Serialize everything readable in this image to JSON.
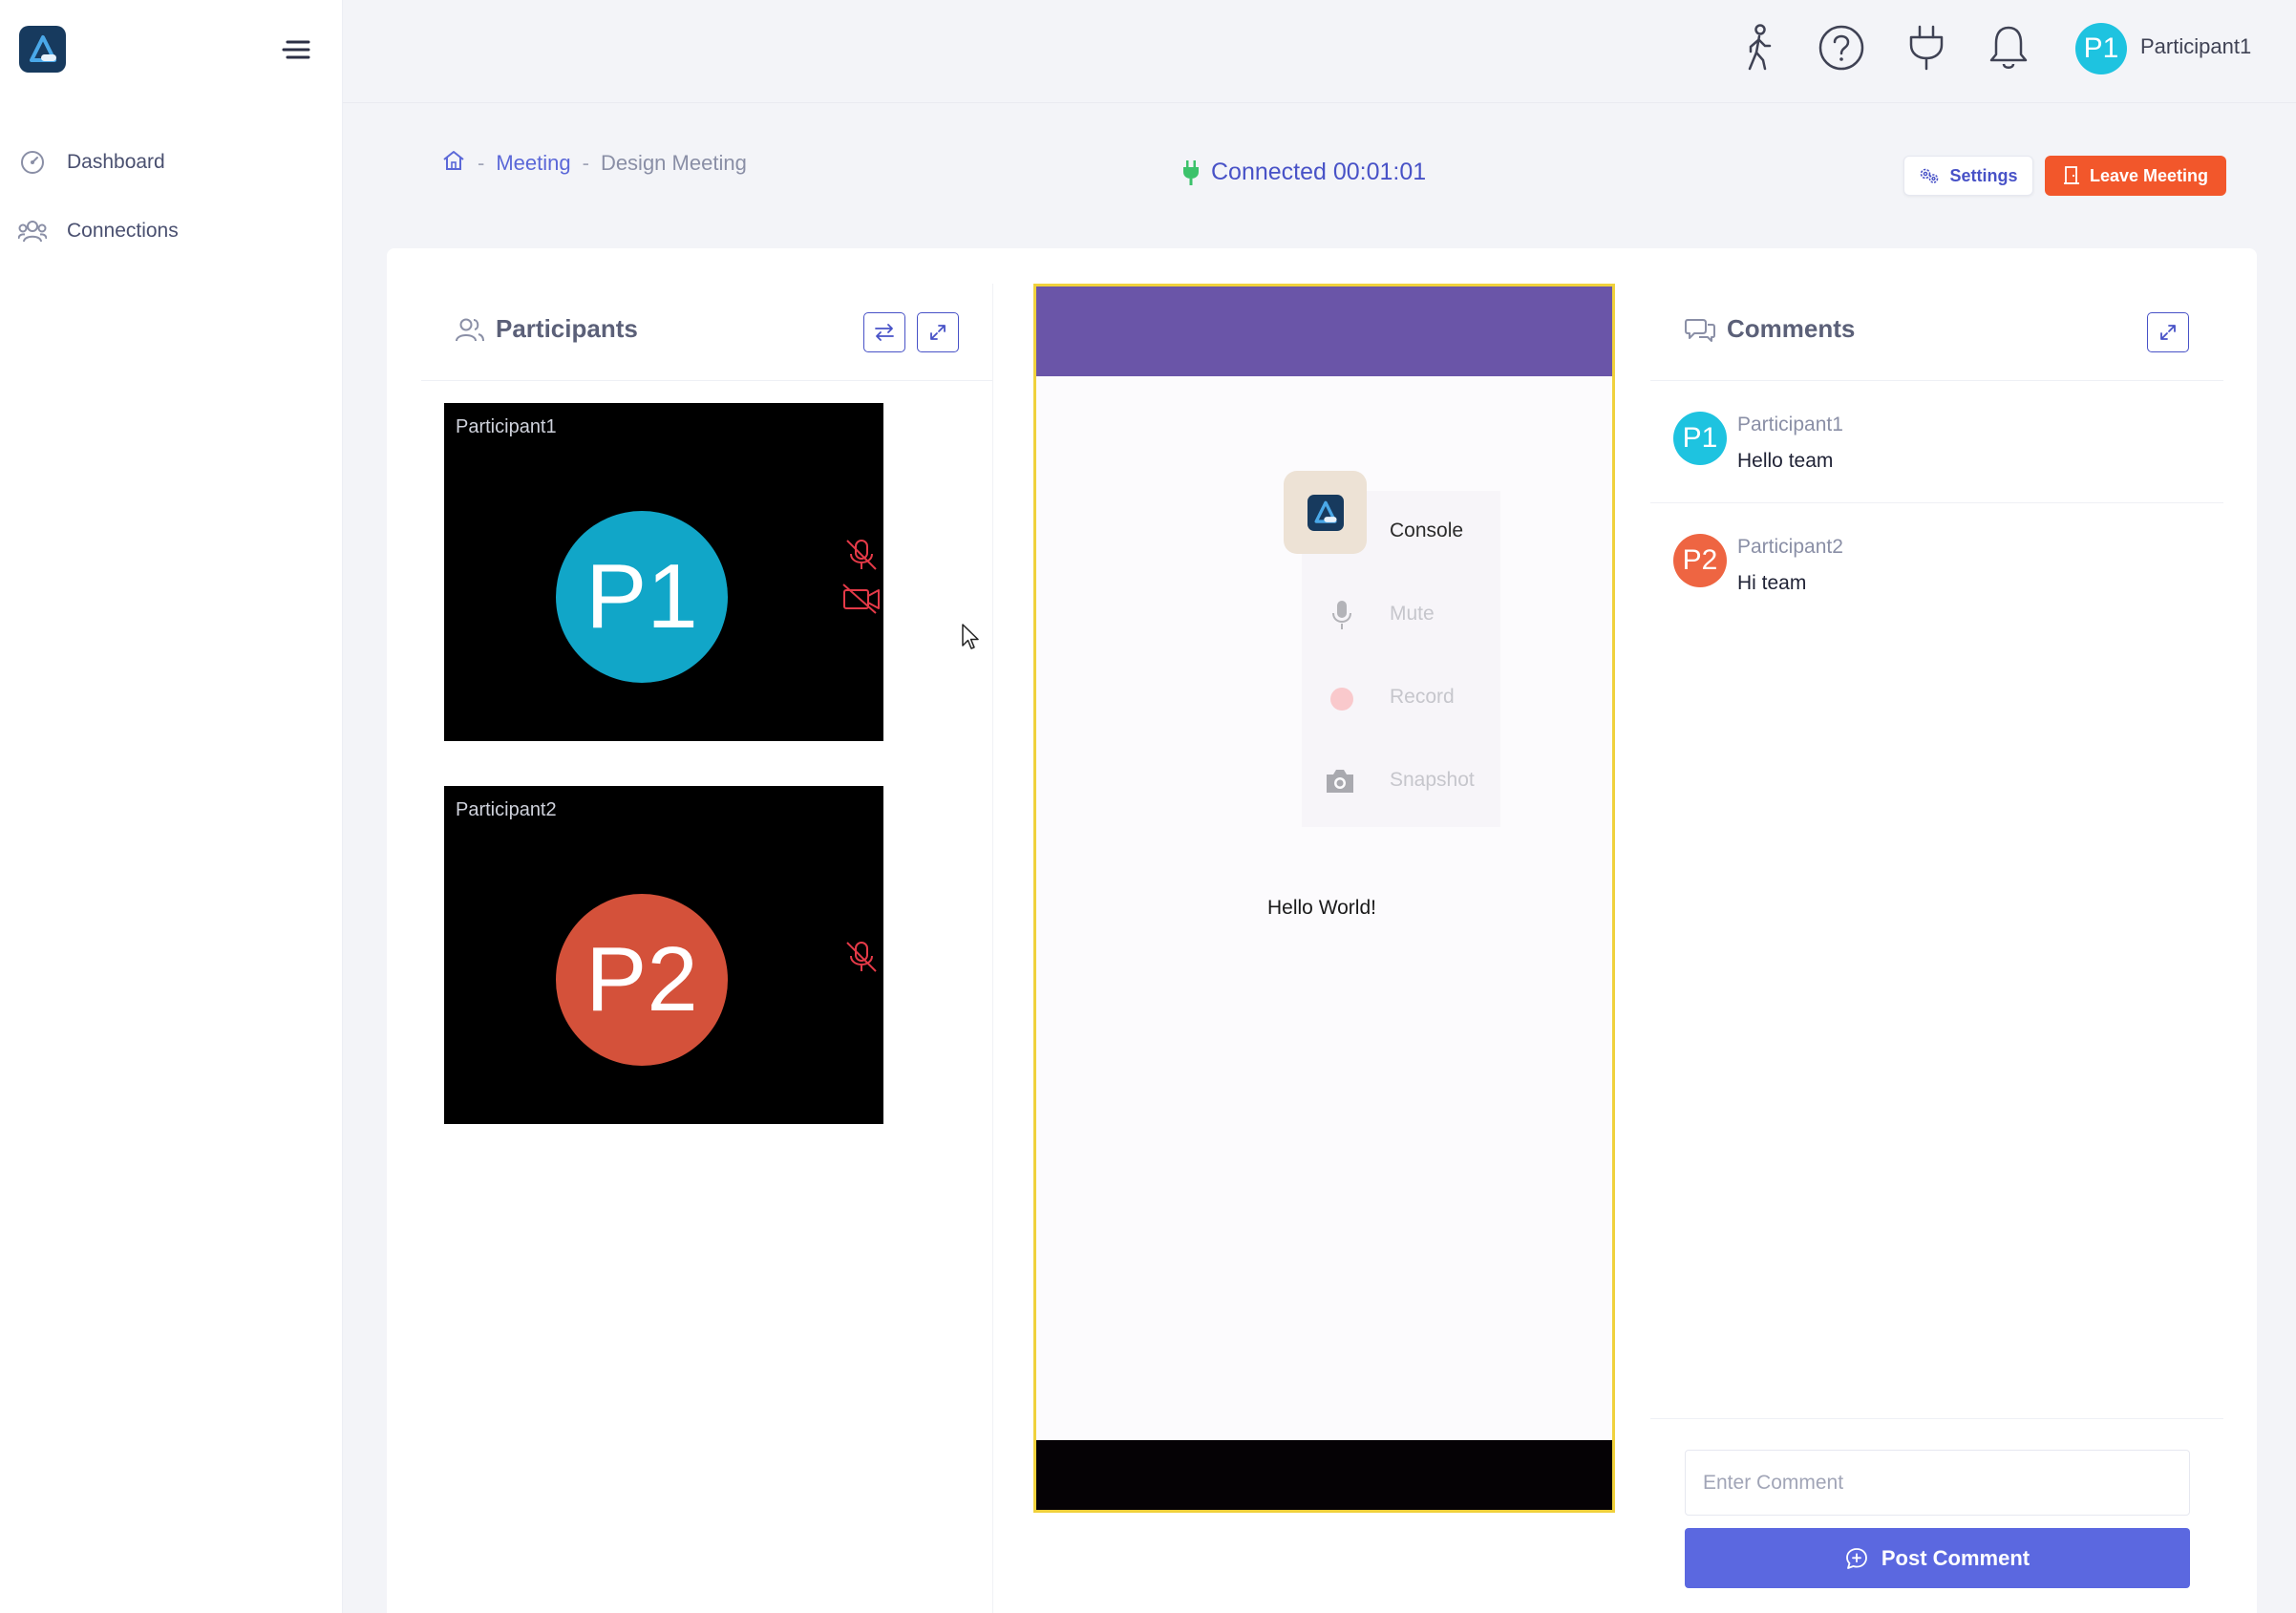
{
  "sidebar": {
    "items": [
      {
        "label": "Dashboard",
        "icon": "dashboard-gauge-icon"
      },
      {
        "label": "Connections",
        "icon": "users-icon"
      }
    ]
  },
  "header": {
    "icons": [
      "walking-person-icon",
      "help-circle-icon",
      "plug-icon",
      "bell-icon"
    ],
    "user": {
      "initials": "P1",
      "name": "Participant1",
      "avatar_color": "#1ec3e0"
    }
  },
  "breadcrumb": {
    "home_icon": "home-icon",
    "separator": "-",
    "items": [
      "Meeting",
      "Design Meeting"
    ]
  },
  "status": {
    "text": "Connected 00:01:01",
    "color": "#4852c7",
    "icon_color": "#3cc26b"
  },
  "actions": {
    "settings_label": "Settings",
    "leave_label": "Leave Meeting",
    "leave_color": "#f2572b"
  },
  "participants_panel": {
    "title": "Participants",
    "tiles": [
      {
        "name": "Participant1",
        "initials": "P1",
        "color": "#11a6c8",
        "muted": true,
        "video_off": true
      },
      {
        "name": "Participant2",
        "initials": "P2",
        "color": "#d4513a",
        "muted": true,
        "video_off": false
      }
    ]
  },
  "phone": {
    "header_color": "#6a55a8",
    "menu": [
      {
        "label": "Console",
        "active": true
      },
      {
        "label": "Mute",
        "active": false
      },
      {
        "label": "Record",
        "active": false
      },
      {
        "label": "Snapshot",
        "active": false
      }
    ],
    "content": "Hello World!"
  },
  "comments_panel": {
    "title": "Comments",
    "items": [
      {
        "initials": "P1",
        "name": "Participant1",
        "text": "Hello team",
        "color": "#1ec3e0"
      },
      {
        "initials": "P2",
        "name": "Participant2",
        "text": "Hi team",
        "color": "#ee6542"
      }
    ],
    "input_placeholder": "Enter Comment",
    "post_label": "Post Comment"
  }
}
